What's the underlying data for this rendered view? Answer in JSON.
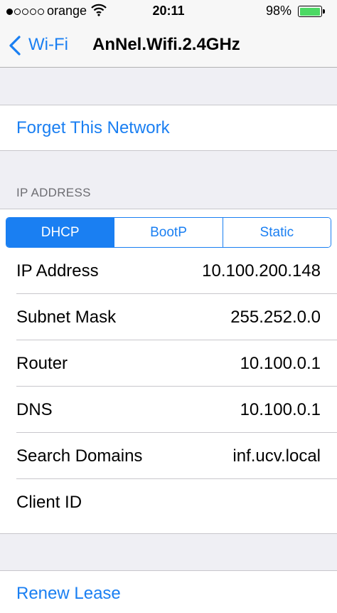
{
  "status_bar": {
    "carrier": "orange",
    "signal_bars_filled": 1,
    "signal_bars_total": 5,
    "time": "20:11",
    "battery_percent": "98%",
    "battery_level": 0.98,
    "battery_color": "#4cd964"
  },
  "nav": {
    "back_label": "Wi-Fi",
    "title": "AnNel.Wifi.2.4GHz"
  },
  "forget_label": "Forget This Network",
  "ip_section": {
    "header": "IP ADDRESS",
    "segments": [
      "DHCP",
      "BootP",
      "Static"
    ],
    "selected_segment": "DHCP",
    "rows": [
      {
        "label": "IP Address",
        "value": "10.100.200.148"
      },
      {
        "label": "Subnet Mask",
        "value": "255.252.0.0"
      },
      {
        "label": "Router",
        "value": "10.100.0.1"
      },
      {
        "label": "DNS",
        "value": "10.100.0.1"
      },
      {
        "label": "Search Domains",
        "value": "inf.ucv.local"
      },
      {
        "label": "Client ID",
        "value": ""
      }
    ]
  },
  "renew_label": "Renew Lease",
  "colors": {
    "accent": "#1a7ff2",
    "background": "#efeff4"
  },
  "icons": [
    "chevron-left-icon",
    "wifi-icon",
    "battery-icon"
  ]
}
